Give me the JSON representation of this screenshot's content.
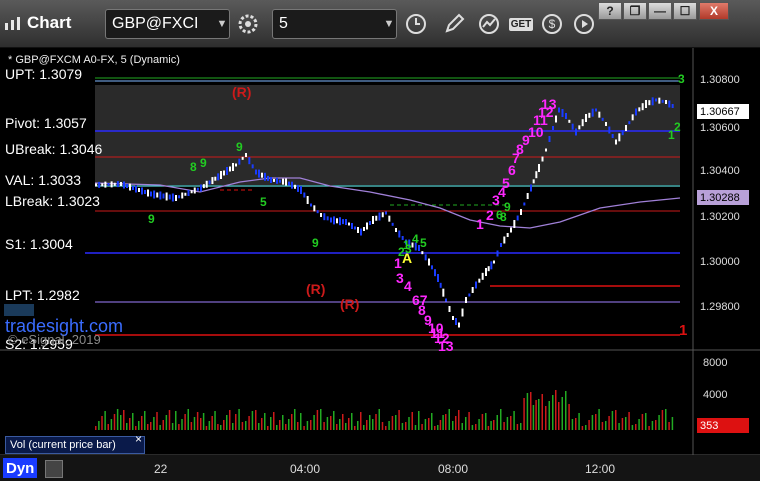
{
  "window": {
    "app_title": "Chart",
    "symbol": "GBP@FXCI",
    "interval": "5",
    "help_btn": "?",
    "restore_btn": "❐",
    "minimize_btn": "—",
    "maximize_btn": "☐",
    "close_btn": "X",
    "get_btn": "GET"
  },
  "chart": {
    "symbol_meta": "* GBP@FXCM A0-FX, 5 (Dynamic)",
    "levels": [
      {
        "label": "UPT: 1.3079",
        "color": "#7fb8ff"
      },
      {
        "label": "Pivot: 1.3057",
        "color": "#2a2aff"
      },
      {
        "label": "UBreak: 1.3046",
        "color": "#cc1a1a"
      },
      {
        "label": "VAL: 1.3033",
        "color": "#44dddd"
      },
      {
        "label": "LBreak: 1.3023",
        "color": "#cc1a1a"
      },
      {
        "label": "S1: 1.3004",
        "color": "#2a2aff"
      },
      {
        "label": "LPT: 1.2982",
        "color": "#a080ff"
      },
      {
        "label": "S2: 1.2959",
        "color": "#cc1a1a"
      }
    ],
    "price_ticks": [
      "1.30800",
      "1.30600",
      "1.30400",
      "1.30200",
      "1.30000",
      "1.29800"
    ],
    "last_price": "1.30667",
    "ma_price": "1.30288",
    "watermark": "tradesight.com",
    "copyright": "© eSignal, 2019",
    "volume_label": "Vol (current price bar)",
    "volume_ticks": [
      "8000",
      "4000"
    ],
    "volume_last": "353",
    "time_ticks": [
      "22",
      "04:00",
      "08:00",
      "12:00"
    ],
    "bottom_left": "Dyn",
    "markers": {
      "r1": "(R)",
      "r2": "(R)",
      "r3": "(R)",
      "a": "A",
      "one_right": "1",
      "seq_magenta": [
        "1",
        "3",
        "4",
        "67",
        "8",
        "9",
        "10",
        "11",
        "12",
        "13",
        "1",
        "2",
        "3",
        "4",
        "5",
        "6",
        "7",
        "8",
        "9",
        "10",
        "11",
        "12",
        "13"
      ],
      "seq_green": [
        "9",
        "8",
        "9",
        "9",
        "5",
        "9",
        "1",
        "2",
        "3",
        "4",
        "5",
        "6",
        "8",
        "9",
        "1",
        "2",
        "3"
      ]
    }
  },
  "colors": {
    "up": "#ffffff",
    "down": "#1a3cff",
    "magenta": "#ff28ff",
    "green": "#22cc22",
    "r_marker": "#cc1a1a",
    "a_marker": "#ffff33",
    "last_price_bg": "#ffffff",
    "ma_bg": "#b8a0d8",
    "vol_last_bg": "#dd1111"
  }
}
